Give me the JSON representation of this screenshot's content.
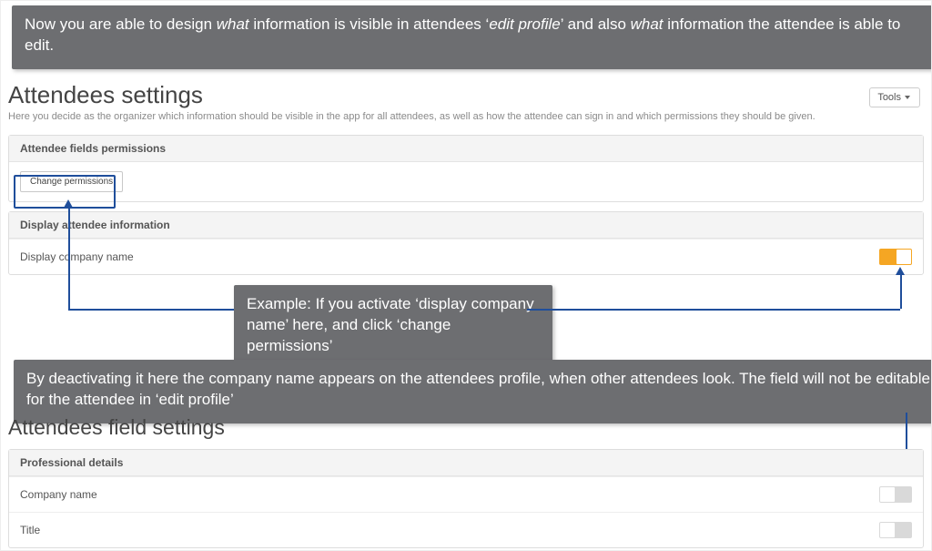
{
  "callouts": {
    "top": "Now you are able to design <em>what</em> information is visible in attendees ‘<em>edit profile</em>’ and also <em>what</em> information the attendee is able to edit.",
    "middle": "Example: If you activate ‘display company name’ here, and click ‘change permissions’",
    "bottom": "By deactivating it here the company name appears on the attendees profile, when other attendees look. The field will not be editable for the attendee in ‘edit profile’"
  },
  "tools_label": "Tools",
  "section1": {
    "title": "Attendees settings",
    "subtitle": "Here you decide as the organizer which information should be visible in the app for all attendees, as well as how the attendee can sign in and which permissions they should be given.",
    "panel_permissions_header": "Attendee fields permissions",
    "change_permissions_label": "Change permissions",
    "panel_display_header": "Display attendee information",
    "display_company_label": "Display company name",
    "display_company_on": true
  },
  "section2": {
    "title": "Attendees field settings",
    "panel_header": "Professional details",
    "rows": {
      "company": "Company name",
      "title": "Title"
    }
  },
  "colors": {
    "accent_blue": "#1f4e9b",
    "toggle_on": "#f5a623",
    "callout_bg": "#6d6e71"
  }
}
